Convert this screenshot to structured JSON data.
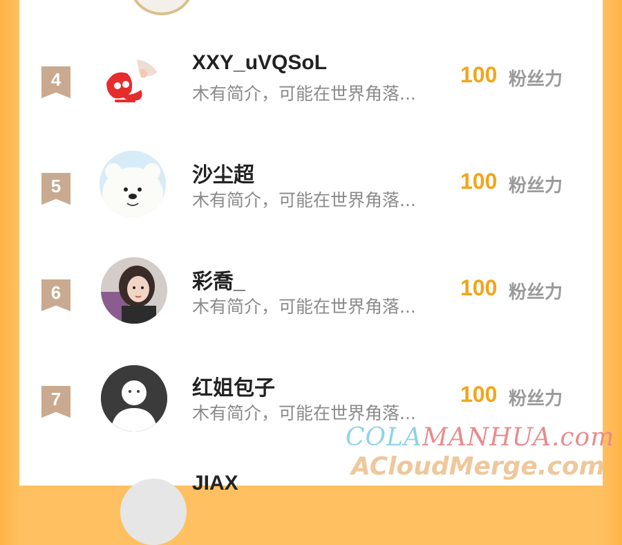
{
  "list": {
    "rows": [
      {
        "rank": "4",
        "name": "XXY_uVQSoL",
        "bio": "木有简介，可能在世界角落...",
        "score": "100",
        "unit": "粉丝力"
      },
      {
        "rank": "5",
        "name": "沙尘超",
        "bio": "木有简介，可能在世界角落...",
        "score": "100",
        "unit": "粉丝力"
      },
      {
        "rank": "6",
        "name": "彩喬_",
        "bio": "木有简介，可能在世界角落...",
        "score": "100",
        "unit": "粉丝力"
      },
      {
        "rank": "7",
        "name": "红姐包子",
        "bio": "木有简介，可能在世界角落...",
        "score": "100",
        "unit": "粉丝力"
      }
    ],
    "partial_row_name": "JIAX"
  },
  "watermark": {
    "line1_a": "COLA",
    "line1_b": "MANHUA.com",
    "line2": "ACloudMerge.com"
  },
  "colors": {
    "background_orange": "#ffc061",
    "score": "#f2a51a",
    "rank_badge": "#c9a98f"
  }
}
